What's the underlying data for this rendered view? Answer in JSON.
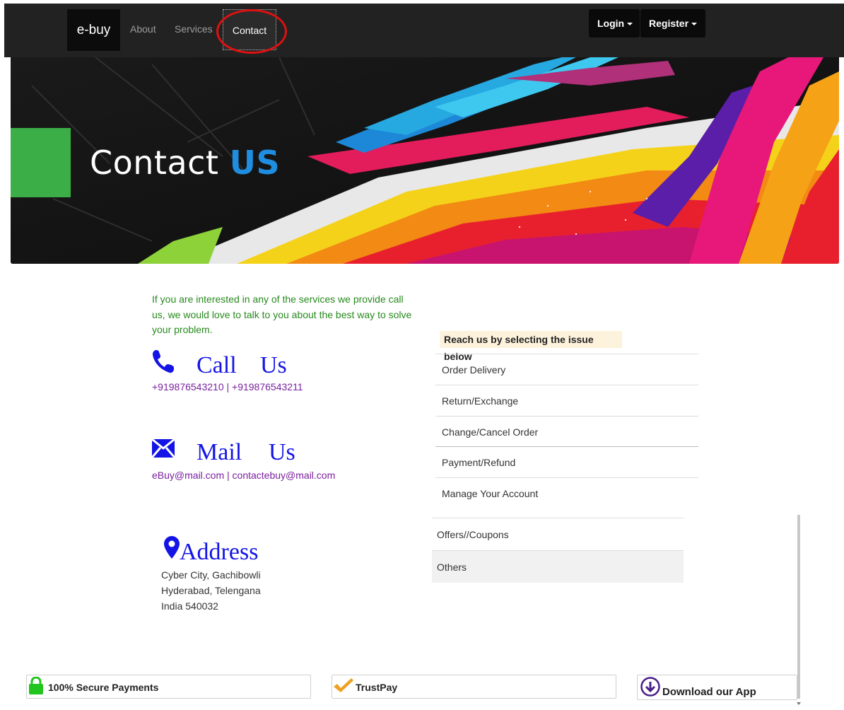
{
  "navbar": {
    "brand": "e-buy",
    "links": [
      "About",
      "Services",
      "Contact"
    ],
    "login_label": "Login",
    "register_label": "Register"
  },
  "banner": {
    "title_part1": "Contact",
    "title_part2": "US"
  },
  "intro_text": "If you are interested in any of the services we provide call us, we would love to talk to you about the best way to solve your problem.",
  "call": {
    "head_word1": "Call",
    "head_word2": "Us",
    "numbers": "+919876543210 | +919876543211"
  },
  "mail": {
    "head_word1": "Mail",
    "head_word2": "Us",
    "emails": "eBuy@mail.com | contactebuy@mail.com"
  },
  "address": {
    "head": "Address",
    "line1": "Cyber City, Gachibowli",
    "line2": "Hyderabad, Telengana",
    "line3": "India 540032"
  },
  "issues": {
    "heading": "Reach us by selecting the issue below",
    "items": [
      "Order Delivery",
      "Return/Exchange",
      "Change/Cancel Order",
      "Payment/Refund",
      "Manage Your Account",
      "Offers//Coupons",
      "Others"
    ]
  },
  "footer": {
    "secure": "100% Secure Payments",
    "trustpay": "TrustPay",
    "download": "Download our App"
  },
  "colors": {
    "navbar_bg": "#222222",
    "banner_accent": "#1f8de0",
    "intro_text": "#27891d",
    "contact_head": "#1414e6",
    "contact_sub": "#7a1fa0",
    "annotation_circle": "#e01010"
  },
  "icons": [
    "phone-icon",
    "envelope-icon",
    "map-marker-icon",
    "lock-icon",
    "checkmark-icon",
    "download-circle-icon",
    "caret-down-icon"
  ]
}
